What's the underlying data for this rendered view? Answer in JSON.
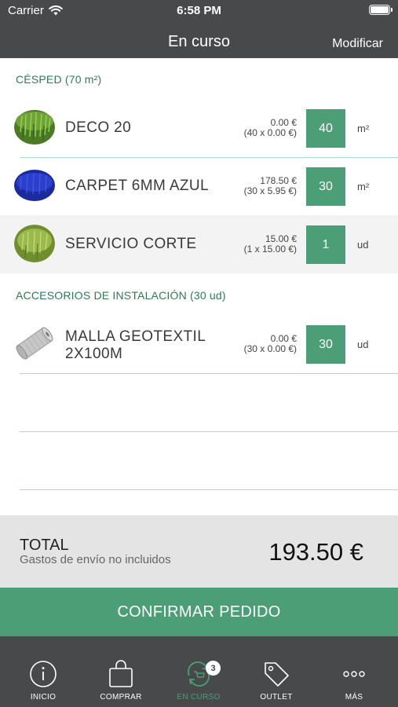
{
  "status_bar": {
    "carrier": "Carrier",
    "time": "6:58 PM"
  },
  "nav": {
    "title": "En curso",
    "modify": "Modificar"
  },
  "sections": [
    {
      "title": "CÉSPED (70 m²)",
      "items": [
        {
          "name": "DECO 20",
          "price": "0.00 €",
          "breakdown": "(40 x 0.00 €)",
          "qty": "40",
          "unit": "m²",
          "thumb_icon": "artificial-grass-thumb"
        },
        {
          "name": "CARPET 6MM AZUL",
          "price": "178.50 €",
          "breakdown": "(30 x 5.95 €)",
          "qty": "30",
          "unit": "m²",
          "thumb_icon": "blue-carpet-thumb"
        },
        {
          "name": "SERVICIO CORTE",
          "price": "15.00 €",
          "breakdown": "(1 x 15.00 €)",
          "qty": "1",
          "unit": "ud",
          "thumb_icon": "grass-cut-thumb"
        }
      ]
    },
    {
      "title": "ACCESORIOS DE INSTALACIÓN (30 ud)",
      "items": [
        {
          "name": "MALLA GEOTEXTIL",
          "name2": "2X100M",
          "price": "0.00 €",
          "breakdown": "(30 x 0.00 €)",
          "qty": "30",
          "unit": "ud",
          "thumb_icon": "geotextile-roll-thumb"
        }
      ]
    }
  ],
  "total": {
    "label": "TOTAL",
    "note": "Gastos de envío no incluidos",
    "amount": "193.50 €"
  },
  "confirm_label": "CONFIRMAR PEDIDO",
  "tabs": [
    {
      "label": "INICIO",
      "icon": "info-icon"
    },
    {
      "label": "COMPRAR",
      "icon": "shopping-bag-icon"
    },
    {
      "label": "EN CURSO",
      "icon": "recycle-cart-icon",
      "badge": "3",
      "active": true
    },
    {
      "label": "OUTLET",
      "icon": "tag-icon"
    },
    {
      "label": "MÁS",
      "icon": "more-icon"
    }
  ],
  "colors": {
    "bar": "#48494b",
    "accent": "#4b9e75",
    "section": "#2e7a56",
    "total_bg": "#e4e4e4"
  }
}
